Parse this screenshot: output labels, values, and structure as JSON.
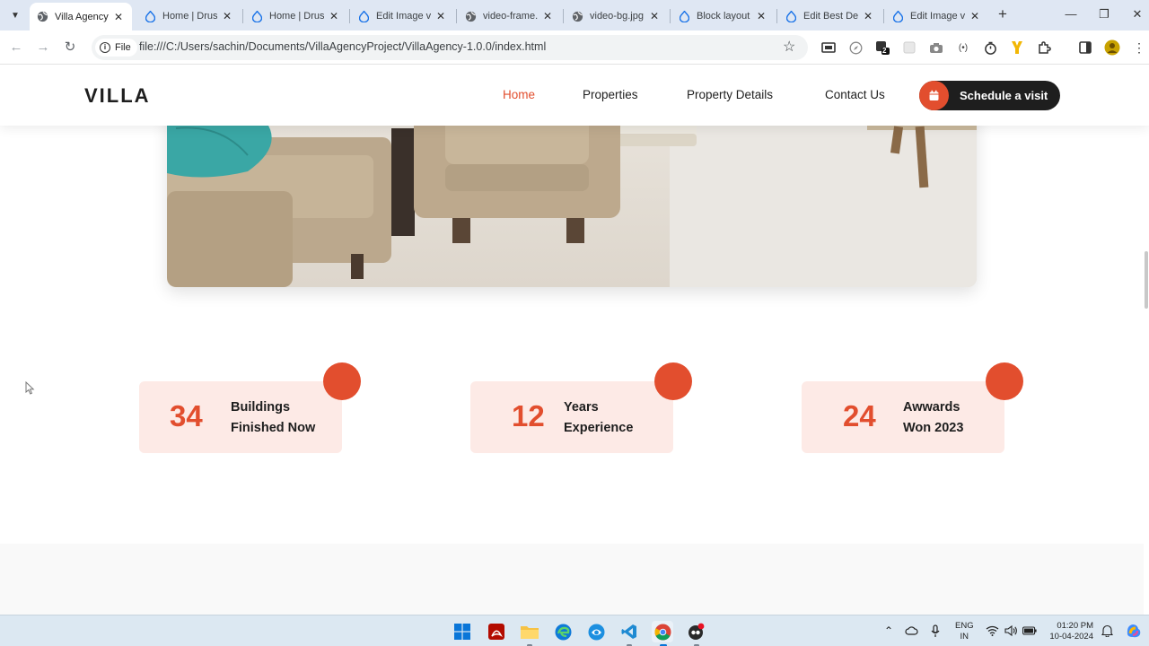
{
  "browser": {
    "tabs": [
      {
        "title": "Villa Agency",
        "icon": "globe-icon",
        "active": true
      },
      {
        "title": "Home | Drus",
        "icon": "drupal-icon",
        "active": false
      },
      {
        "title": "Home | Drus",
        "icon": "drupal-icon",
        "active": false
      },
      {
        "title": "Edit Image vi",
        "icon": "drupal-icon",
        "active": false
      },
      {
        "title": "video-frame.",
        "icon": "globe-icon",
        "active": false
      },
      {
        "title": "video-bg.jpg",
        "icon": "globe-icon",
        "active": false
      },
      {
        "title": "Block layout",
        "icon": "drupal-icon",
        "active": false
      },
      {
        "title": "Edit Best Dea",
        "icon": "drupal-icon",
        "active": false
      },
      {
        "title": "Edit Image vi",
        "icon": "drupal-icon",
        "active": false
      }
    ],
    "new_tab": "+",
    "address": {
      "chip_label": "File",
      "url": "file:///C:/Users/sachin/Documents/VillaAgencyProject/VillaAgency-1.0.0/index.html"
    },
    "extension_badge": "2"
  },
  "site": {
    "logo": "VILLA",
    "nav": [
      {
        "label": "Home",
        "active": true
      },
      {
        "label": "Properties",
        "active": false
      },
      {
        "label": "Property Details",
        "active": false
      },
      {
        "label": "Contact Us",
        "active": false
      }
    ],
    "cta_label": "Schedule a visit",
    "stats": [
      {
        "number": "34",
        "line1": "Buildings",
        "line2": "Finished Now"
      },
      {
        "number": "12",
        "line1": "Years",
        "line2": "Experience"
      },
      {
        "number": "24",
        "line1": "Awwards",
        "line2": "Won 2023"
      }
    ],
    "colors": {
      "accent": "#e24e2e",
      "stat_bg": "#fdeae6",
      "dark": "#1e1e1e"
    }
  },
  "taskbar": {
    "apps": [
      "windows-start-icon",
      "acrobat-icon",
      "file-explorer-icon",
      "edge-icon",
      "app-icon",
      "vscode-icon",
      "chrome-icon",
      "app-icon"
    ],
    "language": {
      "line1": "ENG",
      "line2": "IN"
    },
    "clock": {
      "time": "01:20 PM",
      "date": "10-04-2024"
    }
  }
}
